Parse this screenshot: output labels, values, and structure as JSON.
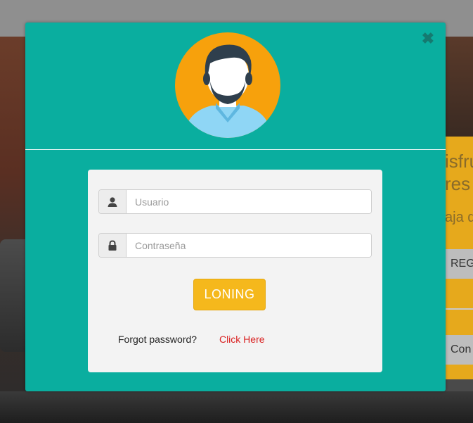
{
  "background": {
    "heading_line1": "isfru",
    "heading_line2": "res",
    "subheading": "aja d",
    "button1_label": "REG",
    "button2_label": "Con"
  },
  "modal": {
    "close_icon": "close-icon",
    "avatar_icon": "user-avatar-icon",
    "username": {
      "placeholder": "Usuario",
      "value": "",
      "icon": "user-icon"
    },
    "password": {
      "placeholder": "Contraseña",
      "value": "",
      "icon": "lock-icon"
    },
    "login_button_label": "LONING",
    "forgot_text": "Forgot password?",
    "forgot_link_label": "Click Here"
  },
  "colors": {
    "modal_bg": "#0aae9f",
    "avatar_bg": "#f7a10c",
    "login_button": "#f5b81c",
    "link": "#d92222",
    "card_bg": "#f3f3f3"
  }
}
